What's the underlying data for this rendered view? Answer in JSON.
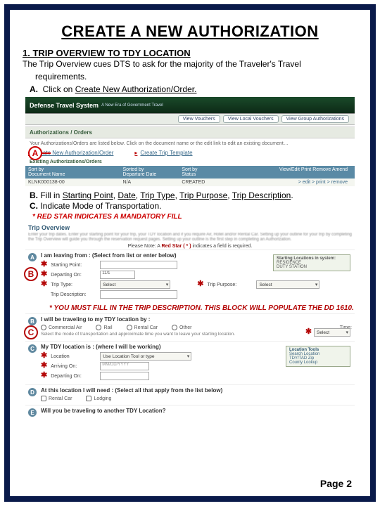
{
  "title": "CREATE A NEW AUTHORIZATION",
  "section": {
    "num_title": "1. TRIP OVERVIEW TO TDY LOCATION",
    "intro": "The Trip Overview cues DTS to ask for the majority of the Traveler's Travel",
    "intro2": "requirements.",
    "A_prefix": "A.",
    "A_text_before": "Click on ",
    "A_link": "Create New Authorization/Order.",
    "B_prefix": "B.",
    "B_text_before": "Fill in ",
    "B_items": [
      "Starting Point",
      "Date",
      "Trip Type",
      "Trip Purpose",
      "Trip Description"
    ],
    "C_prefix": "C.",
    "C_text": "Indicate Mode of Transportation.",
    "red1": "* RED STAR INDICATES A MANDATORY FILL",
    "red2": "* YOU MUST FILL IN THE TRIP DESCRIPTION.  THIS BLOCK WILL POPULATE THE DD 1610."
  },
  "shot1": {
    "logo": "Defense Travel System",
    "logo_sub": "A New Era of Government Travel",
    "nav": [
      "View Vouchers",
      "View Local Vouchers",
      "View Group Authorizations"
    ],
    "panel_title": "Authorizations / Orders",
    "link_create": "Create New Authorization/Order",
    "link_template": "Create Trip Template",
    "existing_label": "Existing Authorizations/Orders",
    "cols": {
      "c1a": "Sort by",
      "c1b": "Document Name",
      "c2a": "Sorted by",
      "c2b": "Departure Date",
      "c3a": "Sort by",
      "c3b": "Status",
      "c4": "View/Edit   Print   Remove   Amend"
    },
    "row": {
      "doc": "KLNK000138-00",
      "date": "N/A",
      "status": "CREATED",
      "actions": "> edit   > print   > remove"
    }
  },
  "shot2": {
    "title": "Trip Overview",
    "note_prefix": "Please Note: A ",
    "note_red": "Red Star ( * )",
    "note_suffix": " indicates a field is required.",
    "stepA": {
      "num": "A",
      "heading_prefix": "I am ",
      "heading_bold": "leaving from",
      "heading_suffix": " :   (Select from list or enter below)",
      "lbl_start": "Starting Point:",
      "lbl_depart": "Departing On:",
      "date_val": "11/1",
      "lbl_triptype": "Trip Type:",
      "triptype_val": "Select",
      "lbl_purpose": "Trip Purpose:",
      "purpose_val": "Select",
      "lbl_desc": "Trip Description:",
      "sidebox_t": "Starting Locations in system:",
      "sidebox_1": "RESIDENCE",
      "sidebox_2": "DUTY STATION"
    },
    "stepB": {
      "num": "B",
      "heading": "I will be traveling to my TDY location by :",
      "modes": [
        "Commercial Air",
        "Rail",
        "Rental Car",
        "Other"
      ],
      "time_lbl": "Time:",
      "time_val": "Select"
    },
    "stepC": {
      "num": "C",
      "heading_prefix": "My ",
      "heading_bold": "TDY location is",
      "heading_suffix": " :   (where I will be working)",
      "lbl_loc": "Location",
      "loc_val": "Use Location Tool or type",
      "lbl_arrive": "Arriving On:",
      "arrive_val": "MM/DD/YYYY",
      "lbl_depart": "Departing On:",
      "sidebox_t": "Location Tools",
      "sidebox_1": "Search Location",
      "sidebox_2": "TDY/TAD Zip",
      "sidebox_3": "County Lookup"
    },
    "stepD": {
      "num": "D",
      "heading": "At this location I will need :   (Select all that apply from the list below)",
      "opt1": "Rental Car",
      "opt2": "Lodging"
    },
    "stepE": {
      "num": "E",
      "heading": "Will you be traveling to another TDY Location?"
    }
  },
  "bubbles": {
    "A": "A",
    "B": "B",
    "C": "C"
  },
  "page": "Page 2"
}
